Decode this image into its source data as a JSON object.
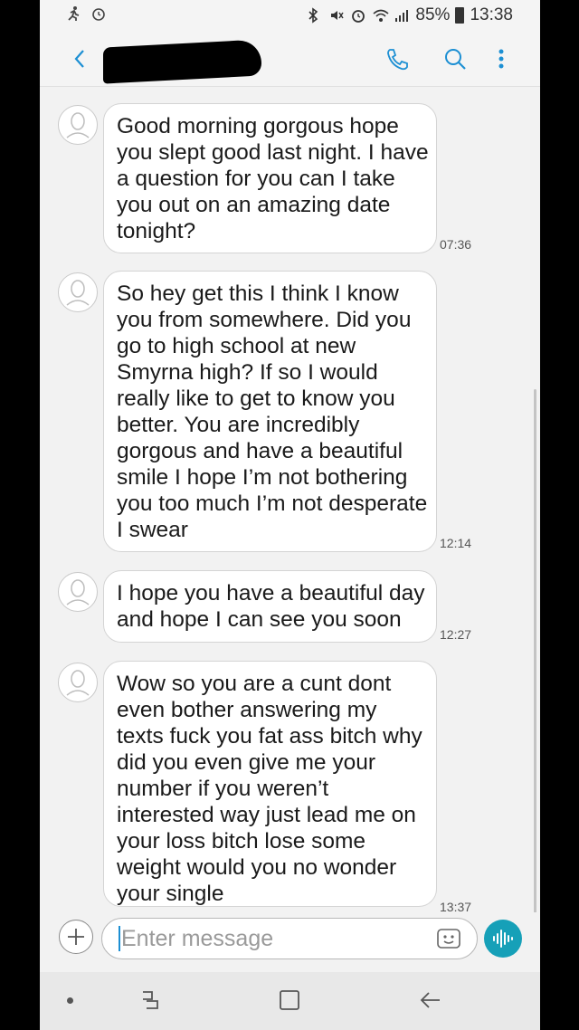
{
  "status_bar": {
    "battery": "85%",
    "time": "13:38"
  },
  "app_bar": {
    "contact_name": "",
    "back_icon": "chevron-left-icon",
    "call_icon": "phone-icon",
    "search_icon": "search-icon",
    "more_icon": "more-vertical-icon"
  },
  "messages": [
    {
      "text": "Good morning gorgous hope you slept good last night. I have a question for you can I take you out on an amazing date tonight?",
      "time": "07:36"
    },
    {
      "text": "So hey get this I think I know you from somewhere. Did you go to high school at new Smyrna high? If so I would really like to get to know you better. You are incredibly gorgous and have a beautiful smile I hope I’m not bothering you too much I’m not desperate I swear",
      "time": "12:14"
    },
    {
      "text": "I hope you have a beautiful day and hope I can see you soon",
      "time": "12:27"
    },
    {
      "text": "Wow so you are a cunt dont even bother answering my texts fuck you fat ass bitch why did you even give me your number if you weren’t interested way just lead me on your loss bitch lose some weight would you no wonder your single",
      "time": "13:37"
    }
  ],
  "composer": {
    "placeholder": "Enter message",
    "attach_icon": "plus-icon",
    "sticker_icon": "sticker-icon",
    "voice_icon": "voice-wave-icon",
    "accent": "#16a0b8"
  },
  "nav_bar": {
    "recent_icon": "recent-apps-icon",
    "home_icon": "home-square-icon",
    "back_icon": "back-arrow-icon"
  }
}
